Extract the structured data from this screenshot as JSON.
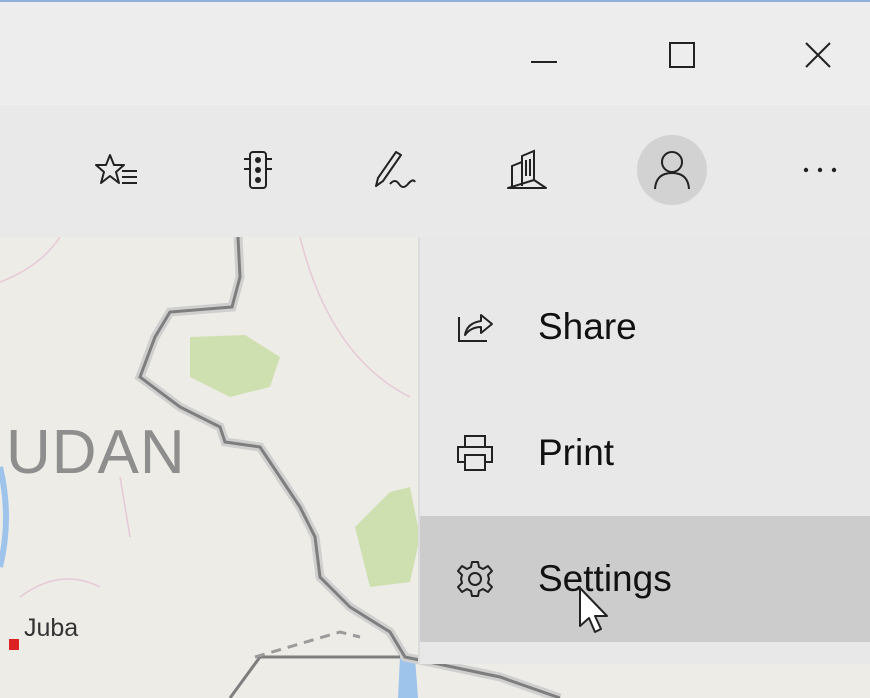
{
  "window": {
    "minimize_icon": "minimize-icon",
    "maximize_icon": "maximize-icon",
    "close_icon": "close-icon"
  },
  "toolbar": {
    "items": [
      {
        "name": "favorites",
        "icon": "favorites-list-icon"
      },
      {
        "name": "traffic",
        "icon": "traffic-light-icon"
      },
      {
        "name": "ink",
        "icon": "pen-ink-icon"
      },
      {
        "name": "3d-cities",
        "icon": "3d-buildings-icon"
      },
      {
        "name": "account",
        "icon": "person-icon"
      },
      {
        "name": "more",
        "icon": "more-dots-icon",
        "label": "..."
      }
    ]
  },
  "menu": {
    "items": [
      {
        "label": "Share",
        "icon": "share-icon"
      },
      {
        "label": "Print",
        "icon": "printer-icon"
      },
      {
        "label": "Settings",
        "icon": "gear-icon",
        "highlighted": true
      }
    ]
  },
  "map": {
    "country_label": "UDAN",
    "city_label": "Juba",
    "colors": {
      "land": "#eeece6",
      "park": "#cfe0b0",
      "water": "#9fc4ec",
      "border": "#7e7e7e"
    }
  }
}
